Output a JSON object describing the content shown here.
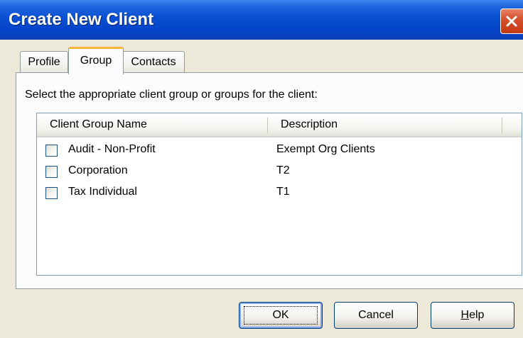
{
  "window": {
    "title": "Create New Client"
  },
  "tabs": [
    {
      "label": "Profile",
      "selected": false
    },
    {
      "label": "Group",
      "selected": true
    },
    {
      "label": "Contacts",
      "selected": false
    }
  ],
  "group_panel": {
    "instruction": "Select the appropriate client group or groups for the client:",
    "columns": {
      "name": "Client Group Name",
      "description": "Description"
    },
    "rows": [
      {
        "name": "Audit - Non-Profit",
        "description": "Exempt Org Clients",
        "checked": false
      },
      {
        "name": "Corporation",
        "description": "T2",
        "checked": false
      },
      {
        "name": "Tax Individual",
        "description": "T1",
        "checked": false
      }
    ]
  },
  "buttons": {
    "ok": "OK",
    "cancel": "Cancel",
    "help_mnemonic": "H",
    "help_rest": "elp"
  },
  "colors": {
    "titlebar": "#0a4fd3",
    "dialog_face": "#ece9d8",
    "selected_tab_accent": "#f7b23a",
    "close_button": "#d6502c"
  },
  "icons": {
    "close": "close-icon"
  }
}
